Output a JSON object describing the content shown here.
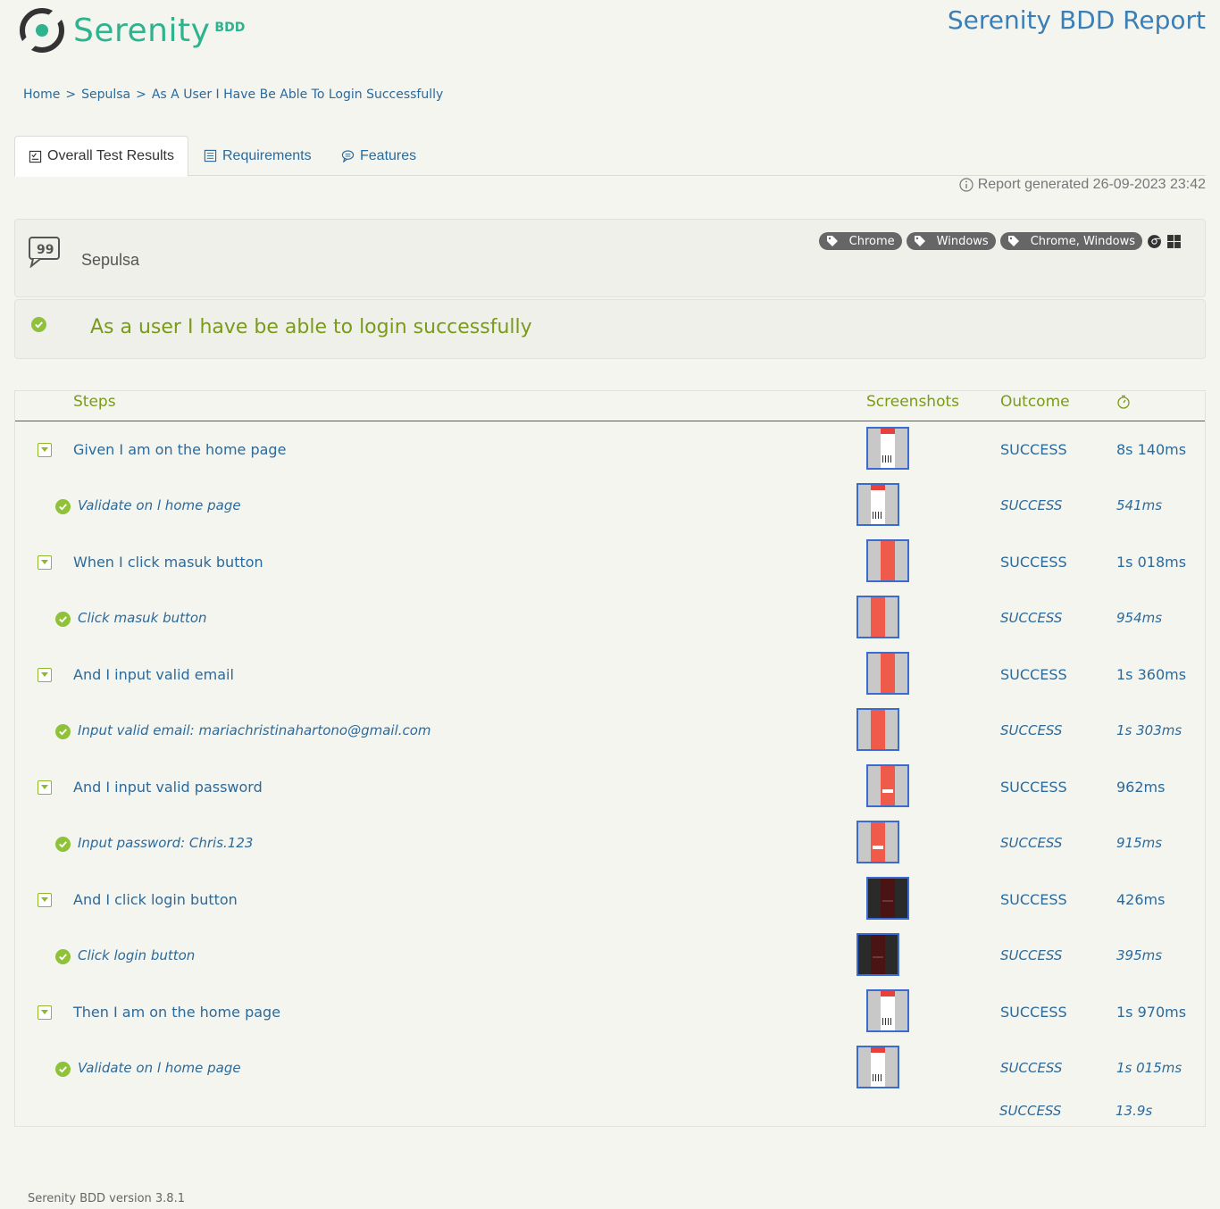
{
  "header": {
    "logo_word": "Serenity",
    "logo_suffix": "BDD",
    "report_title": "Serenity BDD Report"
  },
  "breadcrumb": {
    "home": "Home",
    "sep": ">",
    "feature": "Sepulsa",
    "scenario": "As A User I Have Be Able To Login Successfully"
  },
  "tabs": {
    "overall": "Overall Test Results",
    "requirements": "Requirements",
    "features": "Features"
  },
  "report_generated": "Report generated 26-09-2023 23:42",
  "feature": {
    "name": "Sepulsa",
    "tags": [
      "Chrome",
      "Windows",
      "Chrome, Windows"
    ]
  },
  "scenario": {
    "title": "As a user I have be able to login successfully"
  },
  "steps_table": {
    "headers": {
      "steps": "Steps",
      "screenshots": "Screenshots",
      "outcome": "Outcome"
    },
    "rows": [
      {
        "level": "main",
        "desc": "Given I am on the home page",
        "outcome": "SUCCESS",
        "duration": "8s 140ms",
        "thumb": "home"
      },
      {
        "level": "sub",
        "desc": "Validate on l home page",
        "outcome": "SUCCESS",
        "duration": "541ms",
        "thumb": "home"
      },
      {
        "level": "main",
        "desc": "When I click masuk button",
        "outcome": "SUCCESS",
        "duration": "1s 018ms",
        "thumb": "red"
      },
      {
        "level": "sub",
        "desc": "Click masuk button",
        "outcome": "SUCCESS",
        "duration": "954ms",
        "thumb": "red"
      },
      {
        "level": "main",
        "desc": "And I input valid email",
        "outcome": "SUCCESS",
        "duration": "1s 360ms",
        "thumb": "red"
      },
      {
        "level": "sub",
        "desc": "Input valid email: mariachristinahartono@gmail.com",
        "outcome": "SUCCESS",
        "duration": "1s 303ms",
        "thumb": "red"
      },
      {
        "level": "main",
        "desc": "And I input valid password",
        "outcome": "SUCCESS",
        "duration": "962ms",
        "thumb": "red-mark"
      },
      {
        "level": "sub",
        "desc": "Input password: Chris.123",
        "outcome": "SUCCESS",
        "duration": "915ms",
        "thumb": "red-mark"
      },
      {
        "level": "main",
        "desc": "And I click login button",
        "outcome": "SUCCESS",
        "duration": "426ms",
        "thumb": "dark"
      },
      {
        "level": "sub",
        "desc": "Click login button",
        "outcome": "SUCCESS",
        "duration": "395ms",
        "thumb": "dark"
      },
      {
        "level": "main",
        "desc": "Then I am on the home page",
        "outcome": "SUCCESS",
        "duration": "1s 970ms",
        "thumb": "home"
      },
      {
        "level": "sub",
        "desc": "Validate on l home page",
        "outcome": "SUCCESS",
        "duration": "1s 015ms",
        "thumb": "home"
      }
    ],
    "total_outcome": "SUCCESS",
    "total_duration": "13.9s"
  },
  "footer": "Serenity BDD version 3.8.1",
  "colors": {
    "accent_green": "#7a9a1a",
    "link_blue": "#2b6a9b",
    "success_green": "#8fc13a",
    "logo_teal": "#2fb38e"
  }
}
